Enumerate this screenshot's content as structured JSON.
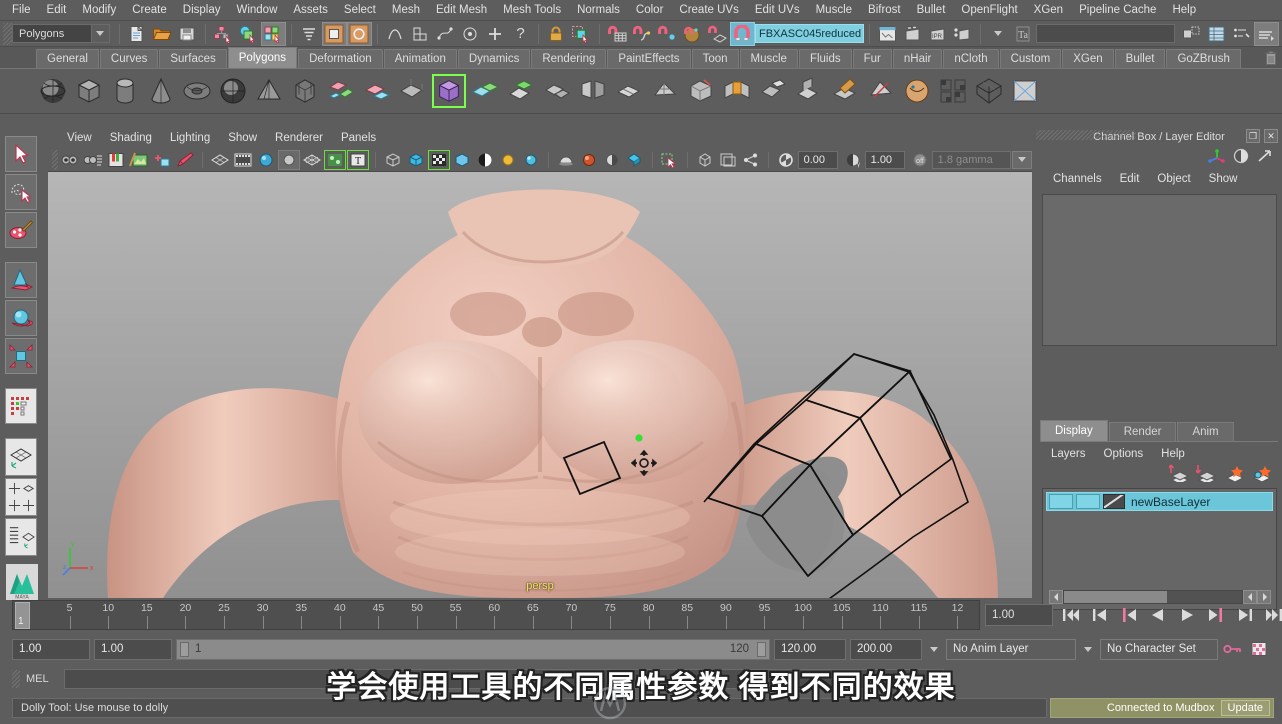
{
  "menubar": {
    "items": [
      "File",
      "Edit",
      "Modify",
      "Create",
      "Display",
      "Window",
      "Assets",
      "Select",
      "Mesh",
      "Edit Mesh",
      "Mesh Tools",
      "Normals",
      "Color",
      "Create UVs",
      "Edit UVs",
      "Muscle",
      "Bifrost",
      "Bullet",
      "OpenFlight",
      "XGen",
      "Pipeline Cache",
      "Help"
    ]
  },
  "statusline": {
    "menu_set": "Polygons",
    "selected_object_name": "FBXASC045reduced",
    "numeric_input_value": "",
    "icons": [
      "new-scene-icon",
      "open-scene-icon",
      "save-scene-icon",
      "select-by-hierarchy-icon",
      "select-by-object-type-icon",
      "select-by-component-type-icon",
      "select-mask-all-icon",
      "select-mask-handle-icon",
      "select-mask-vertex-icon",
      "select-mask-curve-icon",
      "select-mask-pivot-icon",
      "select-mask-plus-icon",
      "help-icon",
      "lock-selection-icon",
      "highlight-selection-icon",
      "snap-to-grid-icon",
      "snap-to-curve-icon",
      "snap-to-point-icon",
      "snap-to-projected-center-icon",
      "snap-to-view-plane-icon",
      "magnet-active-icon",
      "construction-history-icon",
      "render-current-frame-icon",
      "ipr-render-icon",
      "render-settings-icon",
      "batch-render-icon",
      "numeric-input-mode-icon",
      "open-attribute-editor-icon",
      "open-tool-settings-icon",
      "open-channel-box-icon"
    ]
  },
  "shelf": {
    "tabs": [
      "General",
      "Curves",
      "Surfaces",
      "Polygons",
      "Deformation",
      "Animation",
      "Dynamics",
      "Rendering",
      "PaintEffects",
      "Toon",
      "Muscle",
      "Fluids",
      "Fur",
      "nHair",
      "nCloth",
      "Custom",
      "XGen",
      "Bullet",
      "GoZBrush"
    ],
    "active_tab": "Polygons",
    "trash_icon": "trash-icon",
    "icons": [
      "poly-sphere-icon",
      "poly-cube-icon",
      "poly-cylinder-icon",
      "poly-cone-icon",
      "poly-torus-icon",
      "poly-plane-icon",
      "poly-pyramid-icon",
      "poly-prism-icon",
      "poly-pipe-icon",
      "poly-helix-icon",
      "poly-soccer-ball-icon",
      "poly-platonic-icon",
      "combine-icon",
      "extract-icon",
      "booleans-icon",
      "mirror-geometry-icon",
      "smooth-icon",
      "reduce-icon",
      "bevel-icon",
      "bridge-icon",
      "append-polygon-icon",
      "extrude-icon",
      "sculpt-geometry-icon",
      "interactive-split-icon",
      "quad-draw-icon",
      "transfer-attributes-icon",
      "uv-snapshot-icon",
      "sculpt-tool-icon"
    ]
  },
  "toolbox": {
    "tools": [
      "select-tool-icon",
      "lasso-select-tool-icon",
      "paint-selection-tool-icon",
      "move-tool-icon",
      "rotate-tool-icon",
      "scale-tool-icon",
      "last-tool-used-icon",
      "single-perspective-layout-icon",
      "four-view-layout-icon",
      "outliner-persp-layout-icon"
    ],
    "logo": "maya-logo-icon"
  },
  "viewport": {
    "menus": [
      "View",
      "Shading",
      "Lighting",
      "Show",
      "Renderer",
      "Panels"
    ],
    "toolbar_icons": [
      "select-camera-icon",
      "camera-attributes-icon",
      "bookmarks-icon",
      "image-plane-icon",
      "2d-pan-zoom-icon",
      "grease-pencil-icon",
      "wireframe-icon",
      "smooth-shade-icon",
      "shaded-textured-icon",
      "use-default-lighting-icon",
      "shadows-icon",
      "screen-space-ao-icon",
      "motion-blur-icon",
      "multisample-icon",
      "isolate-select-icon",
      "xray-icon",
      "xray-joints-icon",
      "lights-icon",
      "two-sided-lighting-icon",
      "gamma-icon"
    ],
    "exposure_value": "0.00",
    "gamma_value": "1.00",
    "gamma_label": "1.8 gamma",
    "camera_label": "persp",
    "axis_labels": [
      "x",
      "y",
      "z"
    ]
  },
  "right_panel": {
    "title": "Channel Box / Layer Editor",
    "window_buttons": [
      "restore-icon",
      "close-icon"
    ],
    "top_icons": [
      "channel-box-icon",
      "attribute-editor-icon",
      "expand-icon"
    ],
    "channel_menus": [
      "Channels",
      "Edit",
      "Object",
      "Show"
    ],
    "layer_tabs": [
      "Display",
      "Render",
      "Anim"
    ],
    "active_layer_tab": "Display",
    "layer_menus": [
      "Layers",
      "Options",
      "Help"
    ],
    "layer_buttons": [
      "create-empty-layer-icon",
      "create-layer-from-selected-icon",
      "new-layer-icon",
      "new-layer-from-selected-icon"
    ],
    "layers": [
      {
        "name": "newBaseLayer",
        "visible": true,
        "playback": true
      }
    ]
  },
  "timeline": {
    "tick_labels": [
      "5",
      "10",
      "15",
      "20",
      "25",
      "30",
      "35",
      "40",
      "45",
      "50",
      "55",
      "60",
      "65",
      "70",
      "75",
      "80",
      "85",
      "90",
      "95",
      "100",
      "105",
      "110",
      "115",
      "12"
    ],
    "current_frame_marker": "1",
    "current_time_value": "1.00",
    "playback_buttons": [
      "go-to-start-icon",
      "step-back-frame-icon",
      "step-back-key-icon",
      "play-backwards-icon",
      "play-forwards-icon",
      "step-forward-key-icon",
      "step-forward-frame-icon",
      "go-to-end-icon"
    ]
  },
  "range_row": {
    "anim_start": "1.00",
    "range_start": "1.00",
    "range_bar_start": "1",
    "range_bar_end": "120",
    "range_end": "120.00",
    "anim_end": "200.00",
    "anim_layer": "No Anim Layer",
    "character_set": "No Character Set",
    "right_icons": [
      "auto-key-icon",
      "animation-preferences-icon"
    ]
  },
  "command_line": {
    "label": "MEL",
    "input_value": ""
  },
  "help_line": {
    "text": "Dolly Tool: Use mouse to dolly"
  },
  "mudbox_status": {
    "text": "Connected to Mudbox",
    "update_label": "Update"
  },
  "subtitle": {
    "text": "学会使用工具的不同属性参数 得到不同的效果"
  },
  "colors": {
    "ui_background": "#5d5d5d",
    "panel_dark": "#4c4c4c",
    "accent_cyan": "#6bc6da",
    "selection_highlight": "#7fcfe0",
    "mudbox_green": "#8f9264",
    "camera_label_yellow": "#f5e04a"
  }
}
